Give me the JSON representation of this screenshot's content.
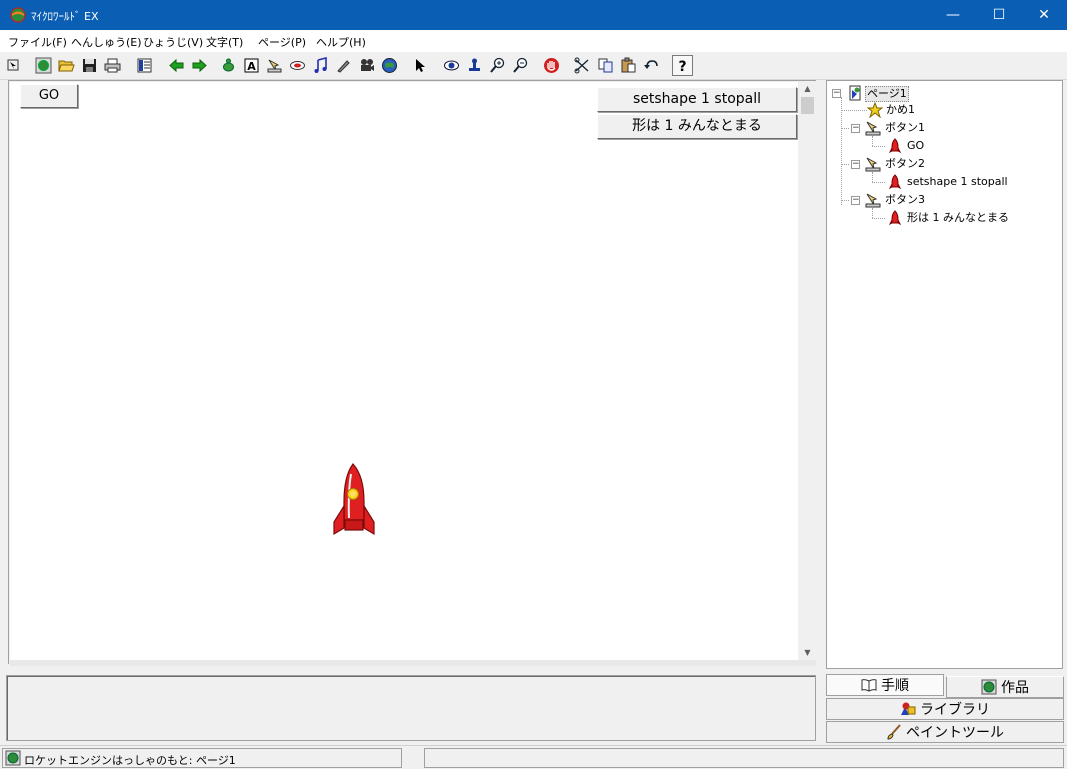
{
  "window": {
    "title": "ﾏｲｸﾛﾜｰﾙﾄﾞ EX",
    "minimize": "—",
    "maximize": "☐",
    "close": "✕"
  },
  "menu": [
    "ファイル(F)",
    "へんしゅう(E)",
    "ひょうじ(V)",
    "文字(T)",
    "ページ(P)",
    "ヘルプ(H)"
  ],
  "toolbar": {
    "icons": [
      "pointer-small-icon",
      "globe-icon",
      "open-folder-icon",
      "save-icon",
      "print-icon",
      "layout-icon",
      "back-arrow-icon",
      "forward-arrow-icon",
      "turtle-icon",
      "text-box-icon",
      "button-tool-icon",
      "eraser-icon",
      "music-note-icon",
      "pen-icon",
      "movie-icon",
      "globe-blue-icon",
      "select-arrow-icon",
      "eye-icon",
      "stamp-icon",
      "zoom-in-icon",
      "zoom-out-icon",
      "stop-hand-icon",
      "cut-icon",
      "copy-icon",
      "paste-icon",
      "undo-icon",
      "help-icon"
    ],
    "text_tool_glyph": "A",
    "help_glyph": "?"
  },
  "canvas": {
    "buttons": [
      {
        "label": "GO"
      },
      {
        "label": "setshape 1 stopall"
      },
      {
        "label": "形は 1 みんなとまる"
      }
    ],
    "scroll_up": "▲",
    "scroll_down": "▼"
  },
  "tree": {
    "page": "ページ1",
    "turtle": "かめ1",
    "button1": "ボタン1",
    "button1_cmd": "GO",
    "button2": "ボタン2",
    "button2_cmd": "setshape 1 stopall",
    "button3": "ボタン3",
    "button3_cmd": "形は 1 みんなとまる",
    "collapse_glyph": "−"
  },
  "panel_tabs": {
    "steps": "手順",
    "works": "作品",
    "library": "ライブラリ",
    "paint": "ペイントツール"
  },
  "status": {
    "text": "ロケットエンジンはっしゃのもと: ページ1"
  },
  "colors": {
    "titlebar": "#0a5fb4",
    "rocket": "#e02020"
  }
}
